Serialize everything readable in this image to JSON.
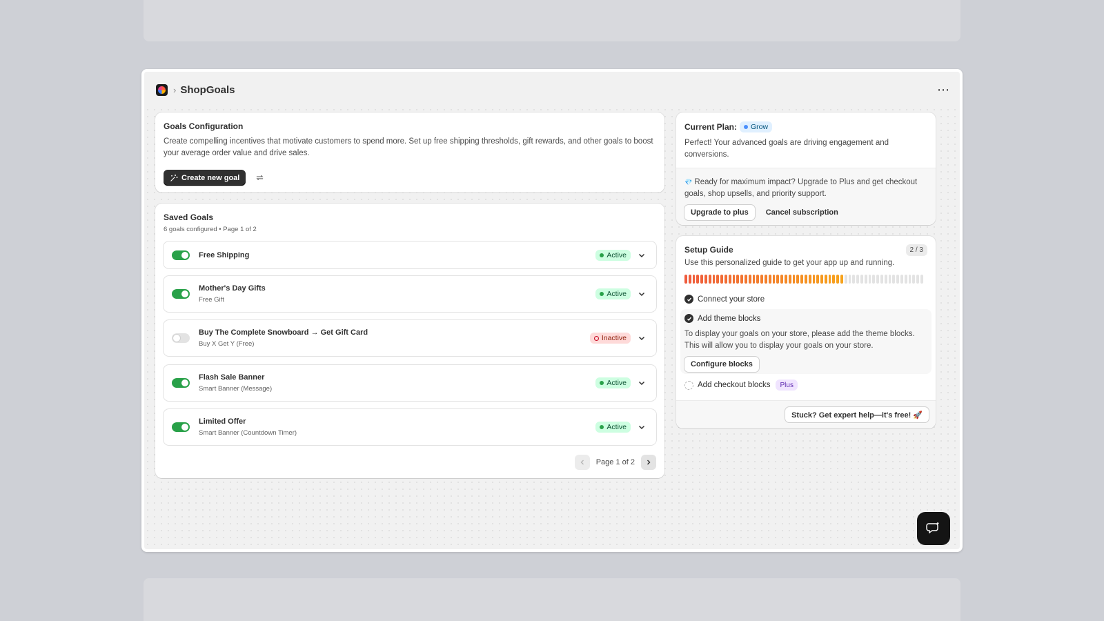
{
  "app": {
    "title": "ShopGoals",
    "breadcrumb_separator": "›",
    "more_icon": "ellipsis-icon",
    "more_label": "⋯"
  },
  "config": {
    "title": "Goals Configuration",
    "description": "Create compelling incentives that motivate customers to spend more. Set up free shipping thresholds, gift rewards, and other goals to boost your average order value and drive sales.",
    "create_label": "Create new goal",
    "create_icon": "magic-sparkle-icon",
    "refresh_icon": "refresh-icon"
  },
  "saved": {
    "title": "Saved Goals",
    "subtitle": "6 goals configured • Page 1 of 2",
    "goals": [
      {
        "name": "Free Shipping",
        "type": "",
        "enabled": true,
        "status": "Active"
      },
      {
        "name": "Mother's Day Gifts",
        "type": "Free Gift",
        "enabled": true,
        "status": "Active"
      },
      {
        "name": "Buy The Complete Snowboard → Get Gift Card",
        "type": "Buy X Get Y (Free)",
        "enabled": false,
        "status": "Inactive"
      },
      {
        "name": "Flash Sale Banner",
        "type": "Smart Banner (Message)",
        "enabled": true,
        "status": "Active"
      },
      {
        "name": "Limited Offer",
        "type": "Smart Banner (Countdown Timer)",
        "enabled": true,
        "status": "Active"
      }
    ],
    "pagination": {
      "label": "Page 1 of 2",
      "prev_icon": "chevron-left-icon",
      "next_icon": "chevron-right-icon"
    }
  },
  "plan": {
    "label": "Current Plan:",
    "plan_name": "Grow",
    "description": "Perfect! Your advanced goals are driving engagement and conversions.",
    "upsell_icon": "💎",
    "upsell_text": "Ready for maximum impact? Upgrade to Plus and get checkout goals, shop upsells, and priority support.",
    "upgrade_label": "Upgrade to plus",
    "cancel_label": "Cancel subscription"
  },
  "guide": {
    "title": "Setup Guide",
    "counter": "2 / 3",
    "description": "Use this personalized guide to get your app up and running.",
    "progress_fraction": 0.667,
    "steps": [
      {
        "label": "Connect your store",
        "done": true
      },
      {
        "label": "Add theme blocks",
        "done": true,
        "detail": "To display your goals on your store, please add the theme blocks. This will allow you to display your goals on your store.",
        "action": "Configure blocks"
      },
      {
        "label": "Add checkout blocks",
        "done": false,
        "badge": "Plus"
      }
    ],
    "help_label": "Stuck? Get expert help—it's free! 🚀"
  },
  "colors": {
    "progress_start": "#ef5b3c",
    "progress_end": "#f7a21b",
    "progress_empty": "#e3e3e3",
    "active_green": "#29a149"
  },
  "chat_icon": "chat-bubble-icon"
}
